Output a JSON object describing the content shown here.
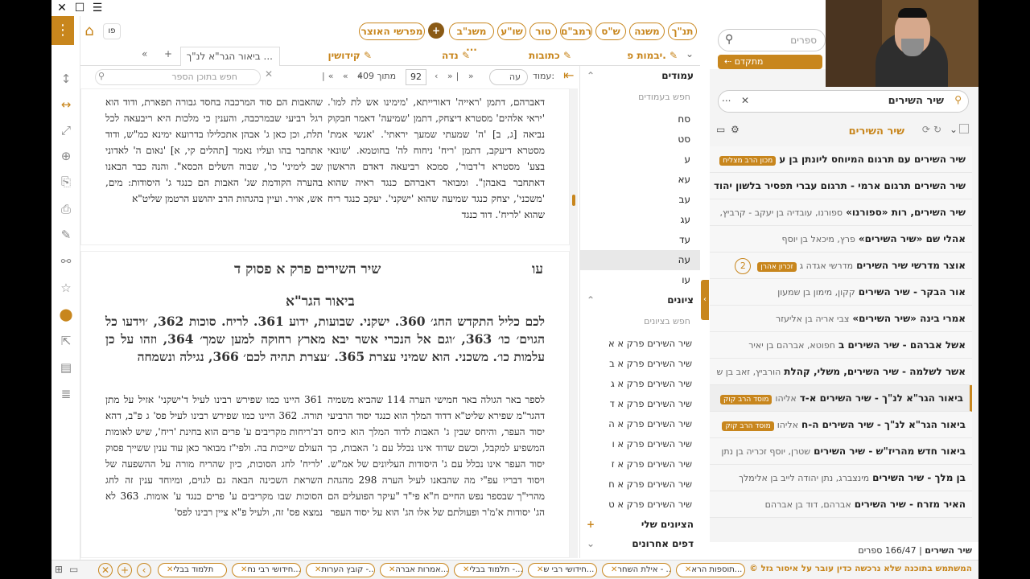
{
  "window": {
    "close": "✕",
    "restore": "☐",
    "menu": "☰"
  },
  "toolbar": {
    "home_label": "⌂",
    "page_label": "פו",
    "plus_label": "+",
    "books": [
      "תנ\"ך",
      "משנה",
      "ש\"ס",
      "רמב\"ם",
      "טור",
      "שו\"ע",
      "משנ\"ב ...",
      "מפרשי האוצר"
    ]
  },
  "tabs": {
    "titles": [
      "יבמות פ.",
      "כתובות",
      "נדה",
      "קידושין",
      "ביאור הגר\"א לנ\"ך ..."
    ]
  },
  "nav": {
    "page_label": "עמוד:",
    "page_value": "עה",
    "page_num": "92",
    "page_total": "מתוך 409",
    "search_placeholder": "חפש בתוכן הספר"
  },
  "upper_text": {
    "right": "דאברהם, דתמן 'ראייה' דאורייתא, 'מימינו אש לת למו'. 'יראי אלהים' מסטרא דיצחק, דתמן 'שמיעה' דאמר חבקוק נביאה [ג, ב] 'ה' שמעתי שמעך יראתי'. 'אנשי אמת' מסטרא דיעקב, דתמן 'ריח' ניחוח לה' בחוטמא. 'שונאי בצע' מסטרא ד'דבור', סמכא רביעאה דאדם הראשון דאתחבר באבהן\". ומבואר דאברהם כנגד ראיה שהוא 'משכני', יצחק כנגד שמיעה שהוא 'ישקני'. יעקב כנגד ריח שהוא 'לריח'. דוד כנגד",
    "left": "שהאבות הם סוד המרכבה בחסד גבורה תפארת, ודוד הוא רגל רביעי שבמרכבה, והענין כי מלכות היא ריבעאה לכל תלת, וכן כאן ג' אבהן אתכלילו בדרועא ימינא כמ\"ש, ודוד אתחבר בהו ועליו נאמר [תהלים קי, א] 'נאום ה' לאדוני שב לימיני' כו', שבוה השלים הכסא\". והנה כבר הבאנו בהערה הקודמת שג' האבות הם כנגד ג' היסודות: מים, אש, אויר. ועיין בהגהות הרב יהושע הרטמן שליט\"א"
  },
  "main": {
    "page_num": "עו",
    "header": "שיר השירים פרק א פסוק ד",
    "section": "ביאור הגר\"א",
    "body": "לכם כליל התקדש החג׳ 360. ישקני. שבועות, ידוע 361. לריח. סוכות 362, ׳וידעו כל הגוים׳ כו׳ 363, ׳וגם אל הנכרי אשר יבא מארץ רחוקה למען שמך׳ 364, וזהו על כן עלמות כו׳. משכני. הוא שמיני עצרת 365. ׳עצרת תהיה לכם׳ 366, נגילה ונשמחה",
    "fn_right": "לספר באר הגולה באר חמישי הערה 114 שהביא משמיה דהגר\"מ שפירא שליט\"א דדוד המלך הוא כנגד יסוד הרביעי יסוד העפר, והיחס שבין ג' האבות לדוד המלך הוא כיחס המשפיע למקבל, וכשם שדוד אינו נכלל עם ג' האבות, כך יסוד העפר אינו נכלל עם ג' היסודות העליונים של אמ\"ש. ויסוד דבריו עפ\"י מה שהבאנו לעיל הערה 298 מהגהת מהרי\"ך שבספר נפש החיים ח\"א פי\"ד \"עיקר הפועלים הם הג' יסודות א'מ'ר ופעולתם של אלו הג' הוא על יסוד העפר",
    "fn_left": "361 היינו כמו שפירש רבינו לעיל ד'ישקני' אזיל על מתן תורה. 362 היינו כמו שפירש רבינו לעיל פס' ג פ\"ב, דהא דב'ריחות מקריבים ע' פרים הוא בחינת 'ריח', שיש לאומות העולם שייכות בה. ולפי\"ז מבואר כאן עוד ענין ששייך פסוק 'לריח' לחג הסוכות, כיון שהריח מורה על ההשפעה של השראת השכינה הבאה גם לגוים, ומיוחד ענין זה לחג הסוכות שבו מקריבים ע' פרים כנגד ע' אומות. 363 לא נמצא פס' זה, ולעיל פ\"א ציין רבינו לפס'"
  },
  "amudim": {
    "title": "עמודים",
    "search": "חפש בעמודים",
    "items": [
      "סח",
      "סט",
      "ע",
      "עא",
      "עב",
      "עג",
      "עד",
      "עה",
      "עו"
    ],
    "active": "עה"
  },
  "tziyunim": {
    "title": "ציונים",
    "search": "חפש בציונים",
    "items": [
      "שיר השירים פרק א א",
      "שיר השירים פרק א ב",
      "שיר השירים פרק א ג",
      "שיר השירים פרק א ד",
      "שיר השירים פרק א ה",
      "שיר השירים פרק א ו",
      "שיר השירים פרק א ז",
      "שיר השירים פרק א ח",
      "שיר השירים פרק א ט"
    ],
    "my": "הציונים שלי",
    "recent": "דפים אחרונים"
  },
  "library": {
    "search_placeholder": "ספרים",
    "advanced": "מתקדם",
    "query": "שיר השירים",
    "more": "...",
    "header": "שיר השירים",
    "count": "166/47 ספרים",
    "footer_title": "שיר השירים",
    "rows": [
      {
        "title": "שיר השירים עם תרגום המיוחס ליונתן בן ע",
        "author": "",
        "badge": "מכון הרב מצליח"
      },
      {
        "title": "שיר השירים תרגום ארמי - תרגום עברי תפסיר בלשון יהוד",
        "author": "",
        "badge": ""
      },
      {
        "title": "שיר השירים, רות «ספורנו»",
        "author": "ספורנו, עובדיה בן יעקב - קרביץ,",
        "badge": ""
      },
      {
        "title": "אהלי שם «שיר השירים»",
        "author": "פרץ, מיכאל בן יוסף",
        "badge": ""
      },
      {
        "title": "אוצר מדרשי שיר השירים",
        "author": "מדרשי אגדה ג",
        "badge": "זכרון אהרן",
        "count": "2"
      },
      {
        "title": "אור הבקר - שיר השירים",
        "author": "קקון, מימון בן שמעון",
        "badge": ""
      },
      {
        "title": "אמרי בינה «שיר השירים»",
        "author": "צבי אריה בן אליעזר",
        "badge": ""
      },
      {
        "title": "אשל אברהם - שיר השירים ב",
        "author": "חפוטא, אברהם בן יאיר",
        "badge": ""
      },
      {
        "title": "אשר לשלמה - שיר השירים, משלי, קהלת",
        "author": "הורביץ, זאב בן ש",
        "badge": ""
      },
      {
        "title": "ביאור הגר\"א לנ\"ך - שיר השירים א-ד",
        "author": "אליהו",
        "badge": "מוסד הרב קוק",
        "sel": true
      },
      {
        "title": "ביאור הגר\"א לנ\"ך - שיר השירים ה-ח",
        "author": "אליהו",
        "badge": "מוסד הרב קוק"
      },
      {
        "title": "ביאור חדש מהריז\"ש - שיר השירים",
        "author": "שטרן, יוסף זכריה בן נתן",
        "badge": ""
      },
      {
        "title": "בן מלך - שיר השירים",
        "author": "מינצברג, נתן יהודה לייב בן אלימלך",
        "badge": ""
      },
      {
        "title": "האיר מזרח - שיר השירים",
        "author": "אברהם, דוד בן אברהם",
        "badge": ""
      }
    ]
  },
  "bottom": {
    "notice": "המשתמש בתוכנה שלא נרכשה כדין עובר על איסור גזל ©",
    "tabs": [
      "תוספות הרא...",
      "אילת השחר - ...",
      "חידושי רבי ש...",
      "תלמוד בבלי -...",
      "אמרות אברה...",
      "קובץ הערות -...",
      "חידושי רבי נח...",
      "תלמוד בבלי"
    ]
  },
  "colors": {
    "accent": "#c8861d"
  }
}
